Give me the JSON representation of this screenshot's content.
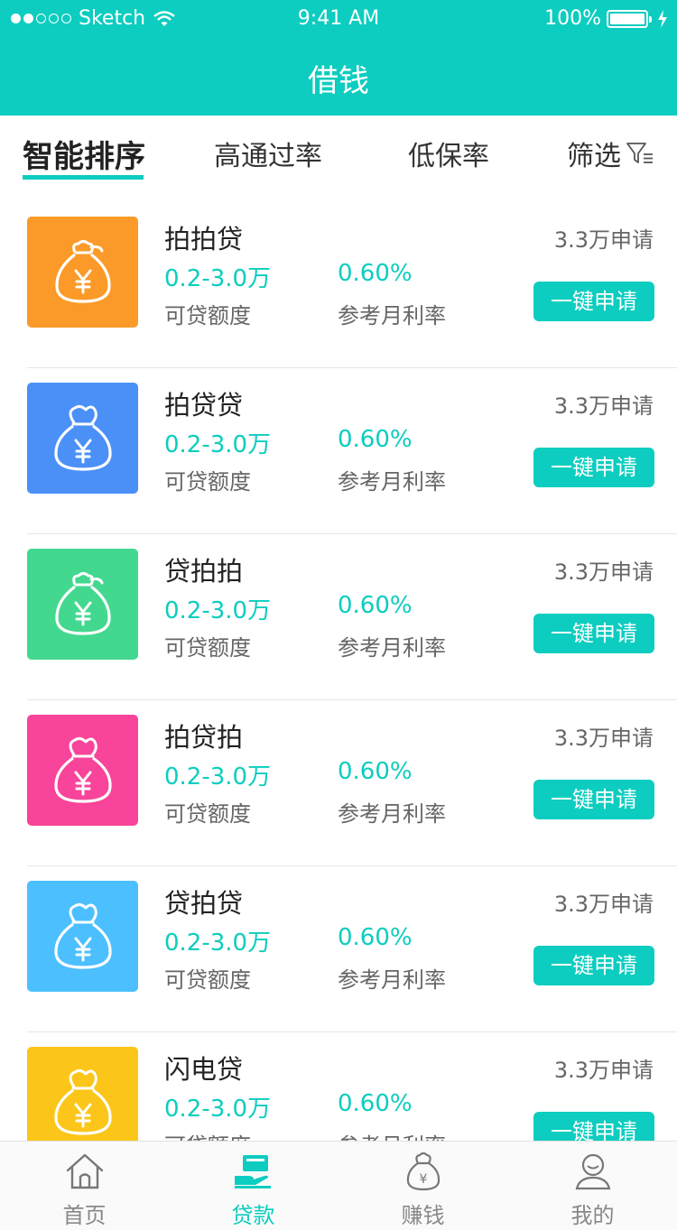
{
  "status_bar": {
    "carrier": "Sketch",
    "time": "9:41 AM",
    "battery": "100%"
  },
  "header": {
    "title": "借钱"
  },
  "sort_tabs": [
    {
      "label": "智能排序",
      "active": true
    },
    {
      "label": "高通过率",
      "active": false
    },
    {
      "label": "低保率",
      "active": false
    },
    {
      "label": "筛选",
      "active": false
    }
  ],
  "loans": [
    {
      "name": "拍拍贷",
      "amount": "0.2-3.0万",
      "amount_label": "可贷额度",
      "rate": "0.60%",
      "rate_label": "参考月利率",
      "applicants": "3.3万申请",
      "button": "一键申请",
      "color": "#fb9a28"
    },
    {
      "name": "拍贷贷",
      "amount": "0.2-3.0万",
      "amount_label": "可贷额度",
      "rate": "0.60%",
      "rate_label": "参考月利率",
      "applicants": "3.3万申请",
      "button": "一键申请",
      "color": "#4a90f7"
    },
    {
      "name": "贷拍拍",
      "amount": "0.2-3.0万",
      "amount_label": "可贷额度",
      "rate": "0.60%",
      "rate_label": "参考月利率",
      "applicants": "3.3万申请",
      "button": "一键申请",
      "color": "#43d88f"
    },
    {
      "name": "拍贷拍",
      "amount": "0.2-3.0万",
      "amount_label": "可贷额度",
      "rate": "0.60%",
      "rate_label": "参考月利率",
      "applicants": "3.3万申请",
      "button": "一键申请",
      "color": "#f8449a"
    },
    {
      "name": "贷拍贷",
      "amount": "0.2-3.0万",
      "amount_label": "可贷额度",
      "rate": "0.60%",
      "rate_label": "参考月利率",
      "applicants": "3.3万申请",
      "button": "一键申请",
      "color": "#4cbfff"
    },
    {
      "name": "闪电贷",
      "amount": "0.2-3.0万",
      "amount_label": "可贷额度",
      "rate": "0.60%",
      "rate_label": "参考月利率",
      "applicants": "3.3万申请",
      "button": "一键申请",
      "color": "#fbc619"
    }
  ],
  "tab_bar": [
    {
      "label": "首页",
      "icon": "home-icon",
      "active": false
    },
    {
      "label": "贷款",
      "icon": "loan-icon",
      "active": true
    },
    {
      "label": "赚钱",
      "icon": "money-bag-icon",
      "active": false
    },
    {
      "label": "我的",
      "icon": "profile-icon",
      "active": false
    }
  ],
  "colors": {
    "accent": "#0ccdbf"
  }
}
